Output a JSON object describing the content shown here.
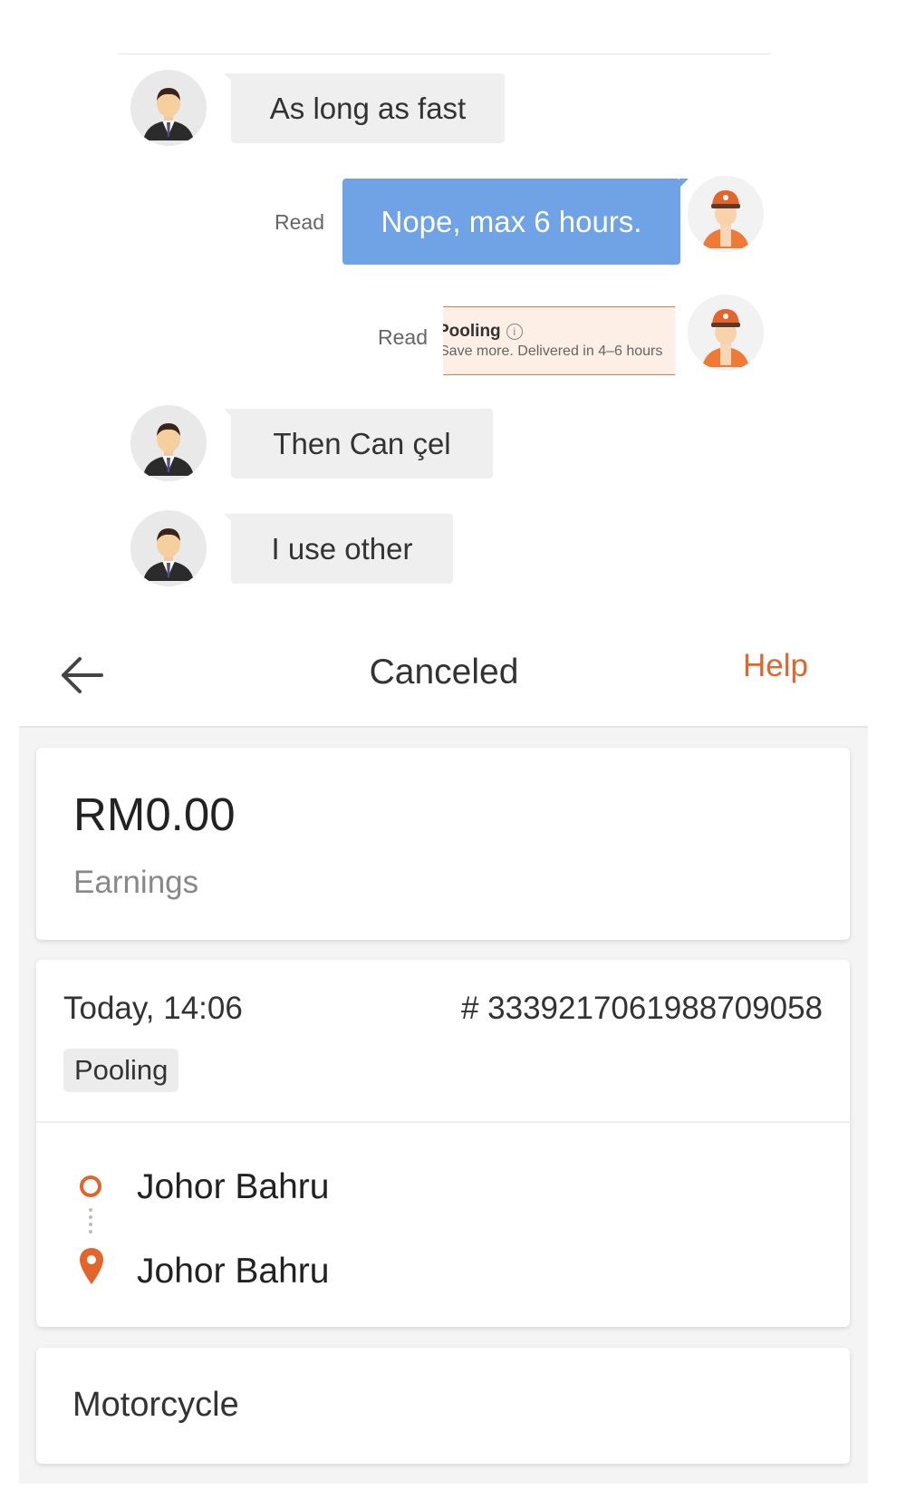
{
  "chat": {
    "messages": [
      {
        "side": "in",
        "text": "As long as fast"
      },
      {
        "side": "out",
        "text": "Nope, max 6 hours.",
        "status": "Read"
      },
      {
        "side": "out-card",
        "card_title": "Pooling",
        "card_text": "Save more. Delivered in 4–6 hours",
        "status": "Read"
      },
      {
        "side": "in",
        "text": "Then Can çel"
      },
      {
        "side": "in",
        "text": "I use other"
      }
    ]
  },
  "order": {
    "header": {
      "title": "Canceled",
      "help_label": "Help",
      "back_icon": "arrow-left-icon"
    },
    "earnings": {
      "amount": "RM0.00",
      "label": "Earnings"
    },
    "details": {
      "time": "Today, 14:06",
      "order_number": "# 3339217061988709058",
      "tag": "Pooling"
    },
    "route": {
      "pickup": "Johor Bahru",
      "dropoff": "Johor Bahru"
    },
    "vehicle": "Motorcycle",
    "colors": {
      "accent": "#e4652c",
      "bubble_out": "#6fa3e6",
      "bubble_in": "#efefef"
    }
  }
}
